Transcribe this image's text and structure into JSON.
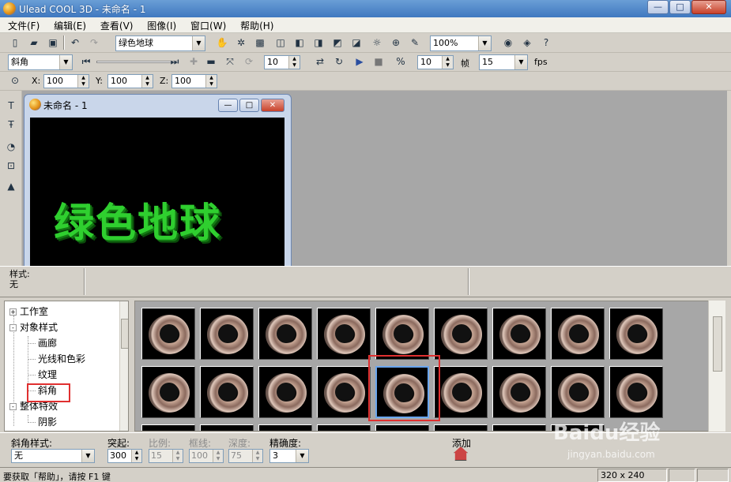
{
  "window": {
    "title": "Ulead COOL 3D - 未命名 - 1"
  },
  "menu": [
    "文件(F)",
    "编辑(E)",
    "查看(V)",
    "图像(I)",
    "窗口(W)",
    "帮助(H)"
  ],
  "toolbar1": {
    "text_combo": "绿色地球",
    "zoom_combo": "100%"
  },
  "toolbar2": {
    "effect_combo": "斜角",
    "frame_value": "10",
    "fps_value": "10",
    "frame_label": "帧",
    "frame_combo": "15",
    "fps_label": "fps"
  },
  "toolbar3": {
    "x_label": "X:",
    "x_value": "100",
    "y_label": "Y:",
    "y_value": "100",
    "z_label": "Z:",
    "z_value": "100"
  },
  "child_window": {
    "title": "未命名 - 1",
    "canvas_text": "绿色地球"
  },
  "style_info": {
    "label": "样式:",
    "value": "无"
  },
  "tree": [
    {
      "label": "工作室",
      "expand": "+"
    },
    {
      "label": "对象样式",
      "expand": "-"
    },
    {
      "label": "画廊"
    },
    {
      "label": "光线和色彩"
    },
    {
      "label": "纹理"
    },
    {
      "label": "斜角"
    },
    {
      "label": "整体特效",
      "expand": "-"
    },
    {
      "label": "阴影"
    }
  ],
  "props": {
    "bevel_style_label": "斜角样式:",
    "bevel_style_value": "无",
    "protrude_label": "突起:",
    "protrude_value": "300",
    "scale_label": "比例:",
    "scale_value": "15",
    "frame_label": "框线:",
    "frame_value": "100",
    "depth_label": "深度:",
    "depth_value": "75",
    "precision_label": "精确度:",
    "precision_value": "3",
    "add_label": "添加"
  },
  "status": {
    "message": "要获取「帮助」，请按 F1 键",
    "resolution": "320 x 240"
  },
  "watermark": {
    "main": "Baidu经验",
    "sub": "jingyan.baidu.com"
  },
  "colors": {
    "highlight": "#e03030",
    "selection": "#6aa6ef",
    "canvas_text": "#2fcf2f"
  }
}
